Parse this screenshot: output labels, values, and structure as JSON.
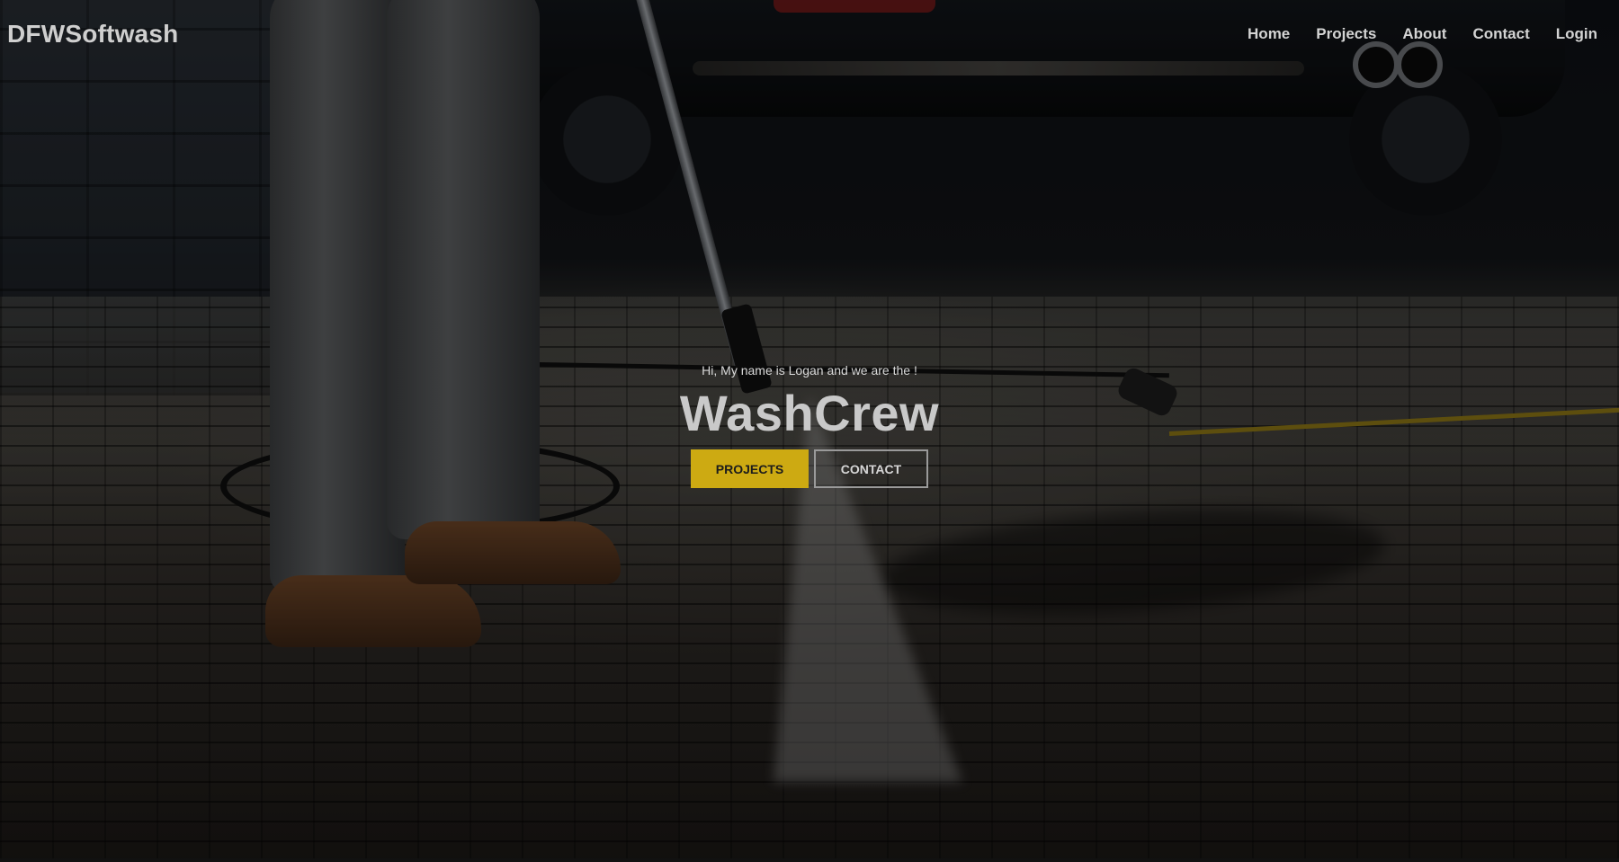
{
  "header": {
    "brand": "DFWSoftwash",
    "nav": [
      {
        "label": "Home"
      },
      {
        "label": "Projects"
      },
      {
        "label": "About"
      },
      {
        "label": "Contact"
      },
      {
        "label": "Login"
      }
    ]
  },
  "hero": {
    "intro": "Hi, My name is Logan and we are the !",
    "title": "WashCrew",
    "buttons": {
      "projects": "PROJECTS",
      "contact": "CONTACT"
    },
    "background_description_icon": "pressure-washing-photo"
  },
  "colors": {
    "accent": "#cdaa12",
    "overlay": "rgba(0,0,0,0.32)"
  }
}
